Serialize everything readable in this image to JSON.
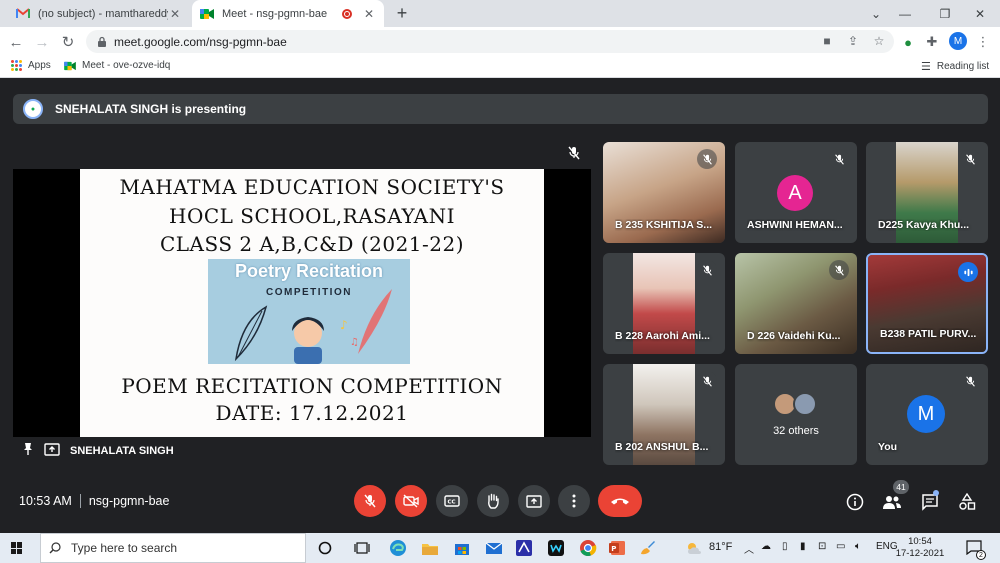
{
  "browser": {
    "tabs": [
      {
        "title": "(no subject) - mamthareddy@m",
        "icon": "gmail-icon"
      },
      {
        "title": "Meet - nsg-pgmn-bae",
        "icon": "meet-icon"
      }
    ],
    "url": "meet.google.com/nsg-pgmn-bae",
    "profile_initial": "M",
    "bookmarks": [
      {
        "label": "Apps"
      },
      {
        "label": "Meet - ove-ozve-idq"
      }
    ],
    "reading_list": "Reading list"
  },
  "meet": {
    "presenting_text": "SNEHALATA SINGH is presenting",
    "presenter_name": "SNEHALATA SINGH",
    "slide": {
      "line1": "MAHATMA EDUCATION SOCIETY'S",
      "line2": "HOCL SCHOOL,RASAYANI",
      "line3": "CLASS 2 A,B,C&D (2021-22)",
      "poster_title": "Poetry Recitation",
      "poster_subtitle": "COMPETITION",
      "line4": "POEM RECITATION COMPETITION",
      "line5": "DATE: 17.12.2021"
    },
    "participants": [
      {
        "name": "B 235 KSHITIJA S...",
        "muted": true
      },
      {
        "name": "ASHWINI HEMAN...",
        "muted": true,
        "avatar": "A",
        "avatar_color": "#e52592"
      },
      {
        "name": "D225 Kavya Khu...",
        "muted": true
      },
      {
        "name": "B 228 Aarohi Ami...",
        "muted": true
      },
      {
        "name": "D 226 Vaidehi Ku...",
        "muted": true
      },
      {
        "name": "B238 PATIL PURV...",
        "muted": false,
        "speaking": true
      },
      {
        "name": "B 202 ANSHUL B...",
        "muted": true
      },
      {
        "name": "32 others"
      },
      {
        "name": "You",
        "muted": true,
        "avatar": "M",
        "avatar_color": "#1a73e8"
      }
    ],
    "time": "10:53 AM",
    "meeting_code": "nsg-pgmn-bae",
    "participant_count": "41",
    "accent_red": "#ea4335"
  },
  "taskbar": {
    "search_placeholder": "Type here to search",
    "weather": "81°F",
    "language": "ENG",
    "time": "10:54",
    "date": "17-12-2021",
    "notification_count": "2"
  }
}
